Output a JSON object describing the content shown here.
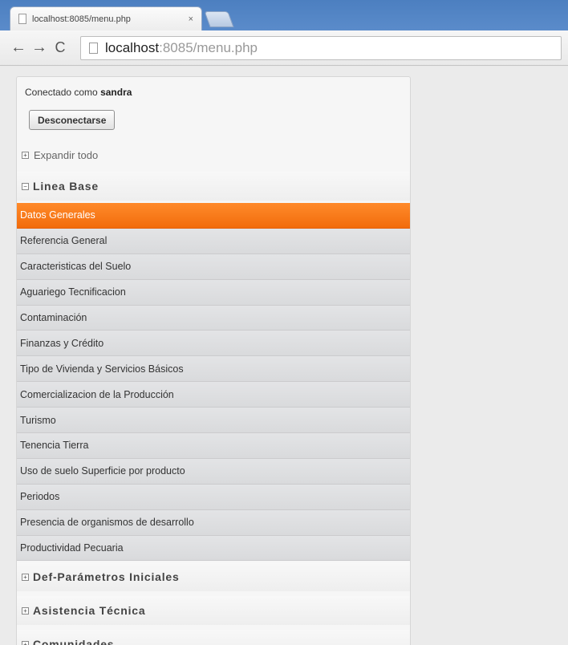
{
  "browser": {
    "tab_title": "localhost:8085/menu.php",
    "tab_close": "×",
    "back_icon": "←",
    "forward_icon": "→",
    "reload_icon": "C",
    "url_host": "localhost",
    "url_rest": ":8085/menu.php"
  },
  "session": {
    "connected_prefix": "Conectado como",
    "username": "sandra",
    "logout_label": "Desconectarse"
  },
  "expand_all": {
    "icon": "⊞",
    "label": "Expandir todo"
  },
  "groups": [
    {
      "label": "Linea Base",
      "expanded": true,
      "items": [
        "Datos Generales",
        "Referencia General",
        "Caracteristicas del Suelo",
        "Aguariego Tecnificacion",
        "Contaminación",
        "Finanzas y Crédito",
        "Tipo de Vivienda y Servicios Básicos",
        "Comercializacion de la Producción",
        "Turismo",
        "Tenencia Tierra",
        "Uso de suelo Superficie por producto",
        "Periodos",
        "Presencia de organismos de desarrollo",
        "Productividad Pecuaria"
      ],
      "active_item": "Datos Generales"
    },
    {
      "label": "Def-Parámetros Iniciales",
      "expanded": false
    },
    {
      "label": "Asistencia Técnica",
      "expanded": false
    },
    {
      "label": "Comunidades",
      "expanded": false
    }
  ],
  "icons": {
    "expanded": "⊟",
    "collapsed": "⊞"
  },
  "colors": {
    "active_item": "#f57214",
    "menu_item_bg": "#dcdddf",
    "browser_frame": "#5b8ccb"
  }
}
